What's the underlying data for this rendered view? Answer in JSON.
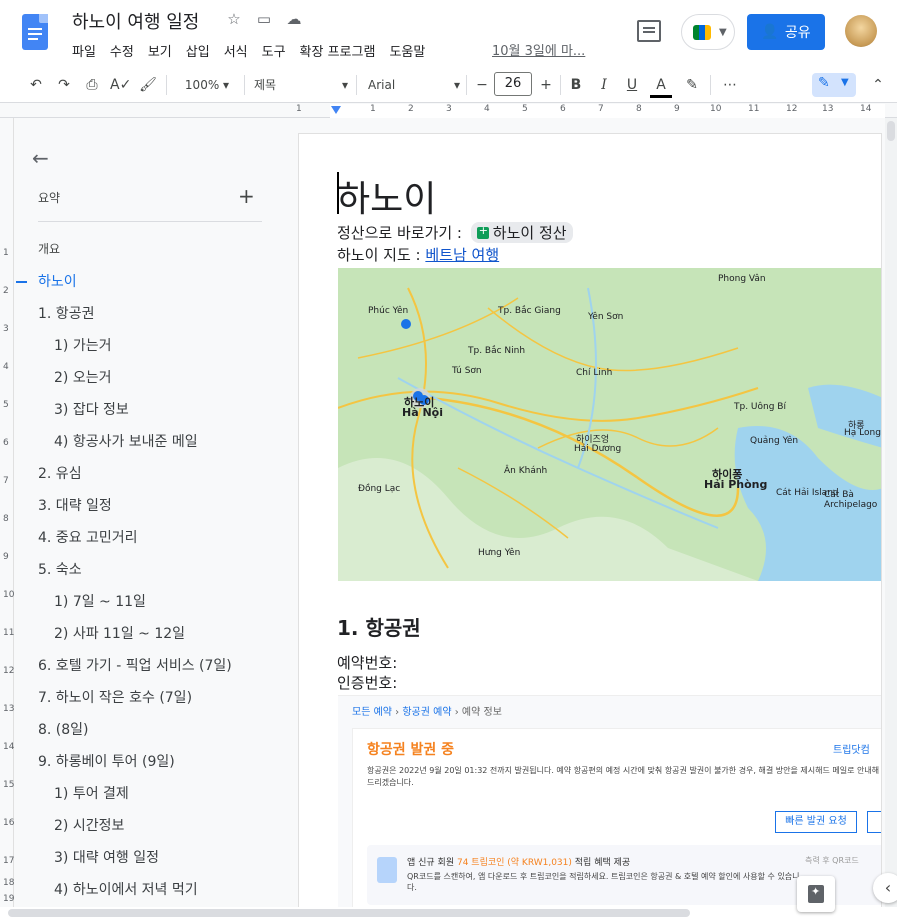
{
  "app": {
    "title": "하노이 여행 일정",
    "menu": [
      "파일",
      "수정",
      "보기",
      "삽입",
      "서식",
      "도구",
      "확장 프로그램",
      "도움말"
    ],
    "last_edit": "10월 3일에 마...",
    "share_label": "공유"
  },
  "toolbar": {
    "zoom": "100%",
    "style": "제목",
    "font": "Arial",
    "font_size": "26",
    "minus": "−",
    "plus": "+",
    "bold": "B",
    "italic": "I",
    "underline": "U",
    "text_color": "A",
    "more": "⋯"
  },
  "ruler": {
    "h_ticks": [
      "1",
      "1",
      "2",
      "3",
      "4",
      "5",
      "6",
      "7",
      "8",
      "9",
      "10",
      "11",
      "12",
      "13",
      "14"
    ],
    "v_ticks": [
      "1",
      "2",
      "3",
      "4",
      "5",
      "6",
      "7",
      "8",
      "9",
      "10",
      "11",
      "12",
      "13",
      "14",
      "15",
      "16",
      "17",
      "18",
      "19"
    ]
  },
  "outline": {
    "summary_label": "요약",
    "summary_add": "+",
    "overview_label": "개요",
    "items": [
      {
        "label": "하노이",
        "level": 1,
        "active": true
      },
      {
        "label": "1. 항공권",
        "level": 1
      },
      {
        "label": "1) 가는거",
        "level": 2
      },
      {
        "label": "2) 오는거",
        "level": 2
      },
      {
        "label": "3) 잡다 정보",
        "level": 2
      },
      {
        "label": "4) 항공사가 보내준 메일",
        "level": 2
      },
      {
        "label": "2. 유심",
        "level": 1
      },
      {
        "label": "3. 대략 일정",
        "level": 1
      },
      {
        "label": "4. 중요 고민거리",
        "level": 1
      },
      {
        "label": "5. 숙소",
        "level": 1
      },
      {
        "label": "1) 7일 ~ 11일",
        "level": 2
      },
      {
        "label": "2) 사파 11일 ~ 12일",
        "level": 2
      },
      {
        "label": "6. 호텔 가기 - 픽업 서비스 (7일)",
        "level": 1
      },
      {
        "label": "7. 하노이 작은 호수 (7일)",
        "level": 1
      },
      {
        "label": "8. (8일)",
        "level": 1
      },
      {
        "label": "9. 하롱베이 투어 (9일)",
        "level": 1
      },
      {
        "label": "1) 투어 결제",
        "level": 2
      },
      {
        "label": "2) 시간정보",
        "level": 2
      },
      {
        "label": "3) 대략 여행 일정",
        "level": 2
      },
      {
        "label": "4) 하노이에서 저녁 먹기",
        "level": 2
      }
    ]
  },
  "document": {
    "title": "하노이",
    "settle_prefix": "정산으로 바로가기 :",
    "settle_chip": "하노이 정산",
    "map_prefix": "하노이 지도 :",
    "map_link": "베트남 여행",
    "map_labels": [
      {
        "text": "Phong Vân",
        "big": false
      },
      {
        "text": "Tp. Bắc Giang",
        "big": false
      },
      {
        "text": "Phúc Yên",
        "big": false
      },
      {
        "text": "Tp. Bắc Ninh",
        "big": false
      },
      {
        "text": "Tú Sơn",
        "big": false
      },
      {
        "text": "Chí Linh",
        "big": false
      },
      {
        "text": "하노이",
        "big": true
      },
      {
        "text": "Hà Nội",
        "big": true
      },
      {
        "text": "하이즈엉",
        "big": false
      },
      {
        "text": "Hải Dương",
        "big": false
      },
      {
        "text": "하이퐁",
        "big": true
      },
      {
        "text": "Hải Phòng",
        "big": true
      },
      {
        "text": "Tp. Uông Bí",
        "big": false
      },
      {
        "text": "Quảng Yên",
        "big": false
      },
      {
        "text": "하롱",
        "big": false
      },
      {
        "text": "Hạ Long",
        "big": false
      },
      {
        "text": "Đồng Lạc",
        "big": false
      },
      {
        "text": "Ân Khánh",
        "big": false
      },
      {
        "text": "Cát Hải Island",
        "big": false
      },
      {
        "text": "Cát Bà Archipelago",
        "big": false
      },
      {
        "text": "Hưng Yên",
        "big": false
      },
      {
        "text": "Yên Sơn",
        "big": false
      }
    ],
    "section1_heading": "1. 항공권",
    "reservation_label": "예약번호:",
    "auth_label": "인증번호:",
    "booking": {
      "crumb_1": "모든 예약",
      "crumb_2": "항공권 예약",
      "crumb_3": "예약 정보",
      "sep": "›",
      "status": "항공권 발권 중",
      "tag": "트립닷컴",
      "desc": "항공권은 2022년 9월 20일 01:32 전까지 발권됩니다. 예약 항공편의 예정 시간에 맞춰 항공권 발권이 불가한 경우, 해결 방안을 제시해드 메일로 안내해 드리겠습니다.",
      "fast_issue_btn": "빠른 발권 요청",
      "promo_title_a": "앱 신규 회원 ",
      "promo_title_b": "74 트립코인 (약 KRW1,031)",
      "promo_title_c": " 적립 혜택 제공",
      "promo_text": "QR코드를 스캔하여, 앱 다운로드 후 트립코인을 적립하세요. 트립코인은 항공권 & 호텔 예약 할인에 사용할 수 있습니다.",
      "qr_label": "측력 후 QR코드"
    }
  },
  "colors": {
    "accent": "#1a73e8",
    "booking_orange": "#f5821f",
    "map_land": "#c6e4b8",
    "map_water": "#9fd3ee"
  }
}
